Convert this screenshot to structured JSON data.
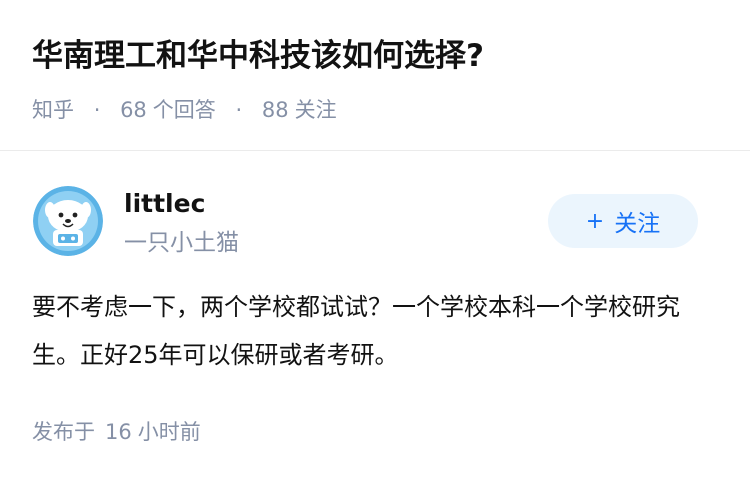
{
  "question": {
    "title": "华南理工和华中科技该如何选择?",
    "source": "知乎",
    "answer_count": "68",
    "answer_label": "个回答",
    "follower_count": "88",
    "follower_label": "关注"
  },
  "answer": {
    "author_name": "littlec",
    "author_bio": "一只小土猫",
    "follow_button_plus": "+",
    "follow_button_label": "关注",
    "content": "要不考虑一下，两个学校都试试？一个学校本科一个学校研究生。正好25年可以保研或者考研。",
    "time_prefix": "发布于",
    "time_value": "16",
    "time_unit": "小时前"
  },
  "colors": {
    "meta_gray": "#8590a6",
    "follow_bg": "#ebf5fd",
    "follow_text": "#1772f6",
    "avatar_bg": "#5bb3e6"
  },
  "icons": {
    "avatar": "cartoon-dog-astronaut-avatar"
  }
}
